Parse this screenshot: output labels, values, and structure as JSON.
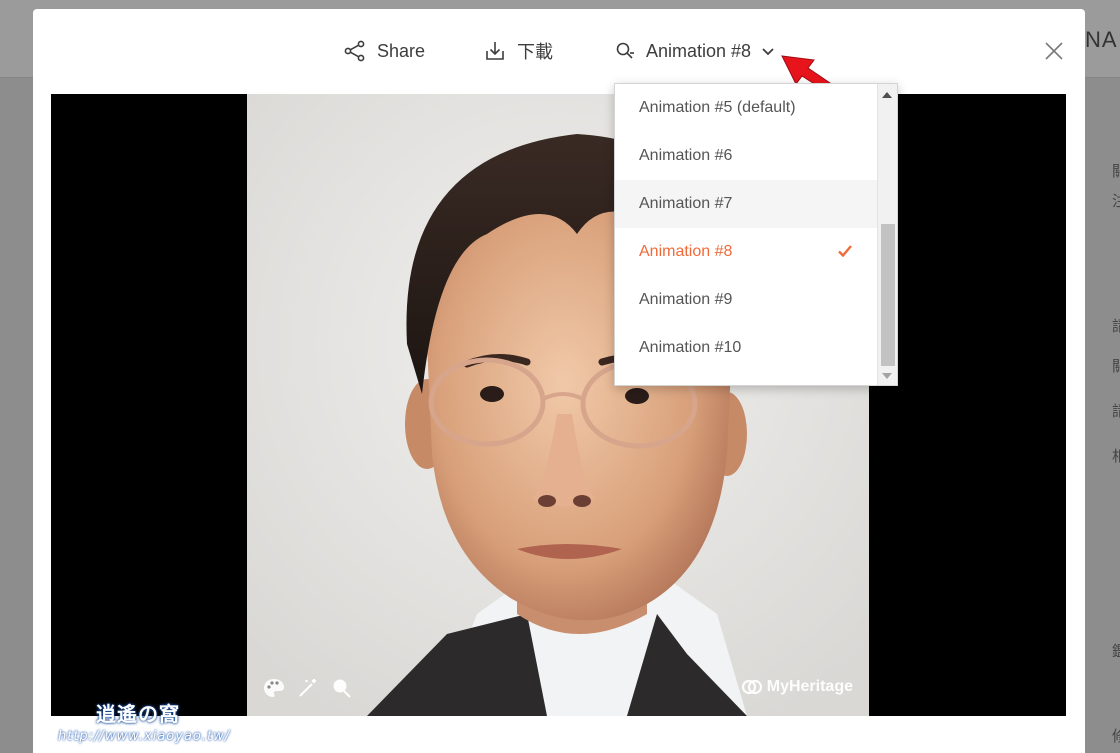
{
  "background": {
    "brand_fragment": "NA",
    "side_glyphs": [
      "關",
      "注",
      "請",
      "關",
      "請",
      "相",
      "鑑",
      "修"
    ]
  },
  "toolbar": {
    "share_label": "Share",
    "download_label": "下載",
    "animation_label": "Animation #8"
  },
  "dropdown": {
    "options": [
      {
        "label": "Animation #5 (default)"
      },
      {
        "label": "Animation #6"
      },
      {
        "label": "Animation #7"
      },
      {
        "label": "Animation #8"
      },
      {
        "label": "Animation #9"
      },
      {
        "label": "Animation #10"
      }
    ],
    "selected_index": 3,
    "hover_index": 2,
    "accent_color": "#ef6b3b"
  },
  "viewer": {
    "brand": "MyHeritage",
    "tool_icons": [
      "palette-icon",
      "magic-wand-icon",
      "animate-icon"
    ]
  },
  "watermark": {
    "logo": "逍遙の窩",
    "url": "http://www.xiaoyao.tw/"
  },
  "colors": {
    "annotation_arrow": "#e8141c",
    "icon_gray": "#3d3d3d"
  }
}
